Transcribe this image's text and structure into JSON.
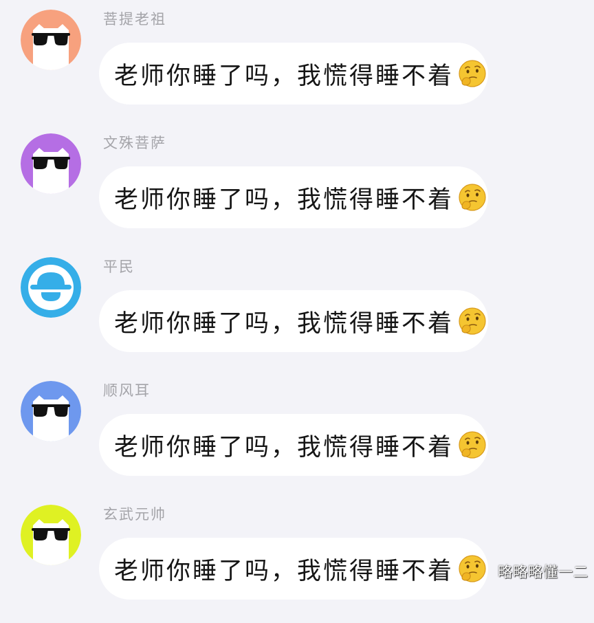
{
  "messages": [
    {
      "sender": "菩提老祖",
      "text": "老师你睡了吗，我慌得睡不着",
      "avatar": {
        "type": "cat-sunglasses-icon",
        "bg": "#f7a17e"
      },
      "emoji": "thinking-face-icon"
    },
    {
      "sender": "文殊菩萨",
      "text": "老师你睡了吗，我慌得睡不着",
      "avatar": {
        "type": "cat-sunglasses-icon",
        "bg": "#b56ee4"
      },
      "emoji": "thinking-face-icon"
    },
    {
      "sender": "平民",
      "text": "老师你睡了吗，我慌得睡不着",
      "avatar": {
        "type": "hat-face-icon",
        "bg": "#35aee8"
      },
      "emoji": "thinking-face-icon"
    },
    {
      "sender": "顺风耳",
      "text": "老师你睡了吗，我慌得睡不着",
      "avatar": {
        "type": "cat-sunglasses-icon",
        "bg": "#6e98ee"
      },
      "emoji": "thinking-face-icon"
    },
    {
      "sender": "玄武元帅",
      "text": "老师你睡了吗，我慌得睡不着",
      "avatar": {
        "type": "cat-sunglasses-icon",
        "bg": "#dff123"
      },
      "emoji": "thinking-face-icon"
    }
  ],
  "watermark": "略略略懂一二"
}
